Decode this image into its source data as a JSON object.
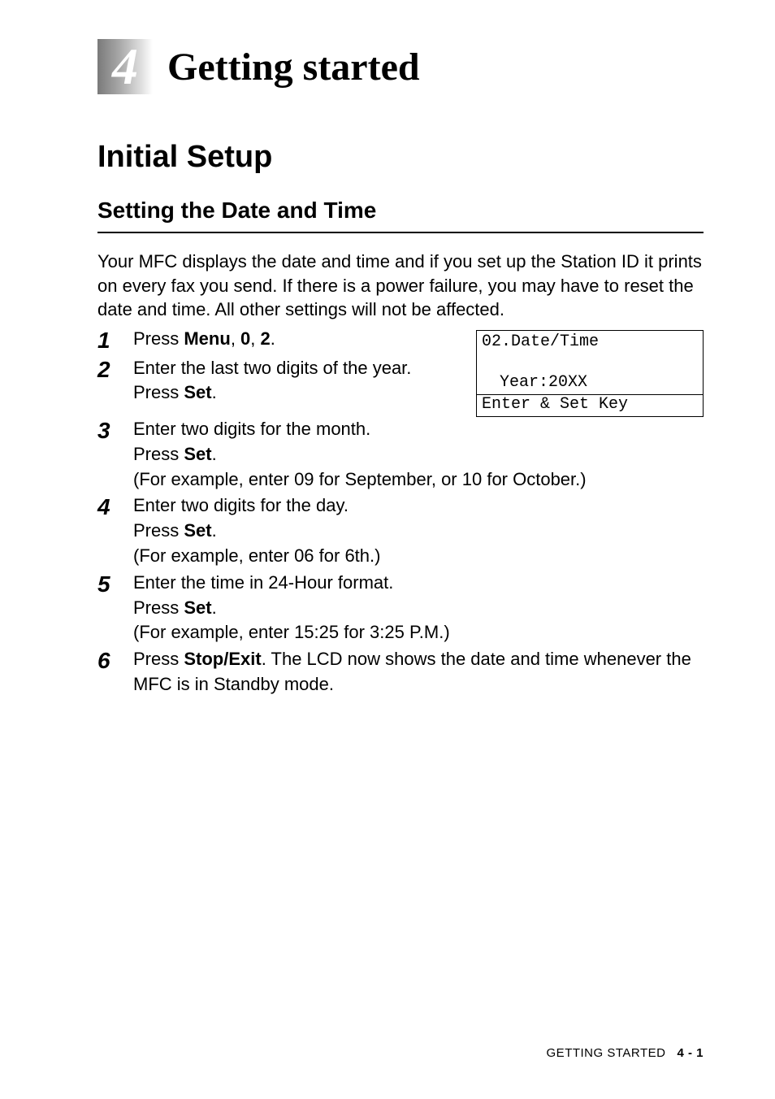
{
  "chapter": {
    "number": "4",
    "title": "Getting started"
  },
  "section": {
    "title": "Initial Setup"
  },
  "subsection": {
    "title": "Setting the Date and Time"
  },
  "intro": "Your MFC displays the date and time and if you set up the Station ID it prints on every fax you send. If there is a power failure, you may have to reset the date and time. All other settings will not be affected.",
  "steps": {
    "s1": {
      "num": "1",
      "pre": "Press ",
      "k1": "Menu",
      "sep1": ", ",
      "k2": "0",
      "sep2": ", ",
      "k3": "2",
      "post": "."
    },
    "s2": {
      "num": "2",
      "line1": "Enter the last two digits of the year.",
      "line2_pre": "Press ",
      "line2_key": "Set",
      "line2_post": "."
    },
    "s3": {
      "num": "3",
      "line1": "Enter two digits for the month.",
      "line2_pre": "Press ",
      "line2_key": "Set",
      "line2_post": ".",
      "line3": "(For example, enter 09 for September, or 10 for October.)"
    },
    "s4": {
      "num": "4",
      "line1": "Enter two digits for the day.",
      "line2_pre": "Press ",
      "line2_key": "Set",
      "line2_post": ".",
      "line3": "(For example, enter 06 for 6th.)"
    },
    "s5": {
      "num": "5",
      "line1": "Enter the time in 24-Hour format.",
      "line2_pre": "Press ",
      "line2_key": "Set",
      "line2_post": ".",
      "line3": "(For example, enter 15:25 for 3:25 P.M.)"
    },
    "s6": {
      "num": "6",
      "pre": "Press ",
      "key": "Stop/Exit",
      "post": ". The LCD now shows the date and time whenever the MFC is in Standby mode."
    }
  },
  "lcd": {
    "line1": "02.Date/Time",
    "line2": "Year:20XX",
    "line3": "Enter & Set Key"
  },
  "footer": {
    "label": "GETTING STARTED",
    "page": "4 - 1"
  }
}
